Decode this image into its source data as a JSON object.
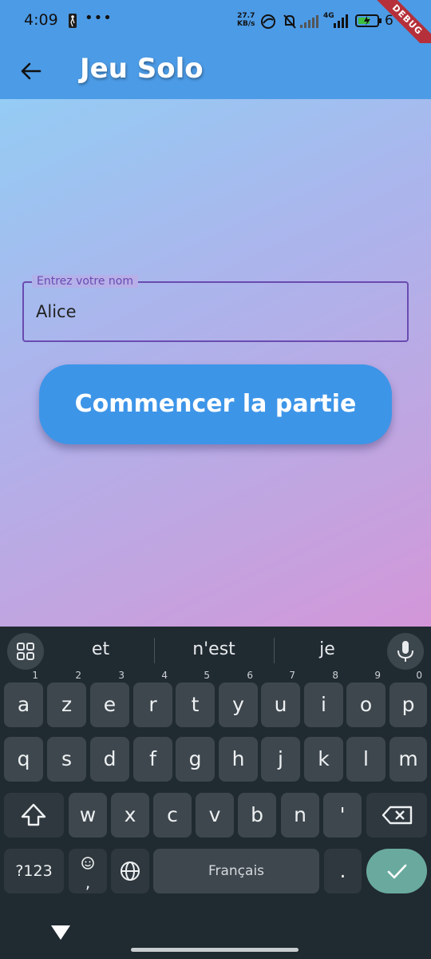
{
  "status_bar": {
    "time": "4:09",
    "dots": "•••",
    "net_rate_value": "27.7",
    "net_rate_unit": "KB/s",
    "network_label": "4G",
    "battery_text": "6",
    "debug_label": "DEBUG"
  },
  "app_bar": {
    "title": "Jeu Solo",
    "color": "#4c9be6"
  },
  "form": {
    "name_label": "Entrez votre nom",
    "name_value": "Alice",
    "start_button": "Commencer la partie",
    "accent_color": "#6a4bb0",
    "button_color": "#3d95e8"
  },
  "keyboard": {
    "suggestions": [
      "et",
      "n'est",
      "je"
    ],
    "row1": [
      {
        "k": "a",
        "h": "1"
      },
      {
        "k": "z",
        "h": "2"
      },
      {
        "k": "e",
        "h": "3"
      },
      {
        "k": "r",
        "h": "4"
      },
      {
        "k": "t",
        "h": "5"
      },
      {
        "k": "y",
        "h": "6"
      },
      {
        "k": "u",
        "h": "7"
      },
      {
        "k": "i",
        "h": "8"
      },
      {
        "k": "o",
        "h": "9"
      },
      {
        "k": "p",
        "h": "0"
      }
    ],
    "row2": [
      "q",
      "s",
      "d",
      "f",
      "g",
      "h",
      "j",
      "k",
      "l",
      "m"
    ],
    "row3": [
      "w",
      "x",
      "c",
      "v",
      "b",
      "n",
      "'"
    ],
    "symbols_key": "?123",
    "emoji_comma": ",",
    "space_label": "Français",
    "period_key": ".",
    "enter_color": "#6aaa9e"
  }
}
